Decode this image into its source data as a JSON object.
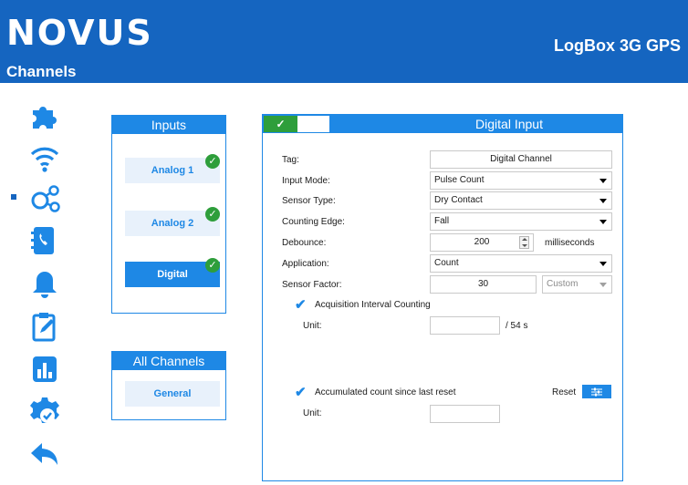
{
  "header": {
    "logo": "NOVUS",
    "page_title": "Channels",
    "device_name": "LogBox 3G GPS"
  },
  "sidebar": {
    "items": [
      {
        "icon": "puzzle-icon"
      },
      {
        "icon": "wifi-icon"
      },
      {
        "icon": "channels-icon",
        "active": true
      },
      {
        "icon": "phone-book-icon"
      },
      {
        "icon": "bell-icon"
      },
      {
        "icon": "clipboard-edit-icon"
      },
      {
        "icon": "bar-chart-icon"
      },
      {
        "icon": "settings-check-icon"
      },
      {
        "icon": "back-arrow-icon"
      }
    ]
  },
  "inputs_panel": {
    "title": "Inputs",
    "channels": [
      {
        "label": "Analog 1",
        "status": "ok"
      },
      {
        "label": "Analog 2",
        "status": "ok"
      },
      {
        "label": "Digital",
        "status": "ok",
        "selected": true
      }
    ]
  },
  "all_channels_panel": {
    "title": "All Channels",
    "button": "General"
  },
  "digital_input": {
    "title": "Digital Input",
    "enabled_mark": "✓",
    "tag_label": "Tag:",
    "tag_value": "Digital Channel",
    "input_mode_label": "Input Mode:",
    "input_mode_value": "Pulse Count",
    "sensor_type_label": "Sensor Type:",
    "sensor_type_value": "Dry Contact",
    "counting_edge_label": "Counting Edge:",
    "counting_edge_value": "Fall",
    "debounce_label": "Debounce:",
    "debounce_value": "200",
    "debounce_unit": "milliseconds",
    "application_label": "Application:",
    "application_value": "Count",
    "sensor_factor_label": "Sensor Factor:",
    "sensor_factor_value": "30",
    "sensor_factor_mode": "Custom",
    "acq_interval_label": "Acquisition Interval Counting",
    "acq_unit_label": "Unit:",
    "acq_unit_value": "",
    "acq_interval_suffix": "/ 54 s",
    "accumulated_label": "Accumulated count since last reset",
    "reset_label": "Reset",
    "acc_unit_label": "Unit:",
    "acc_unit_value": ""
  },
  "colors": {
    "brand": "#1565c0",
    "accent": "#1e88e5",
    "ok": "#2e9e3b"
  }
}
